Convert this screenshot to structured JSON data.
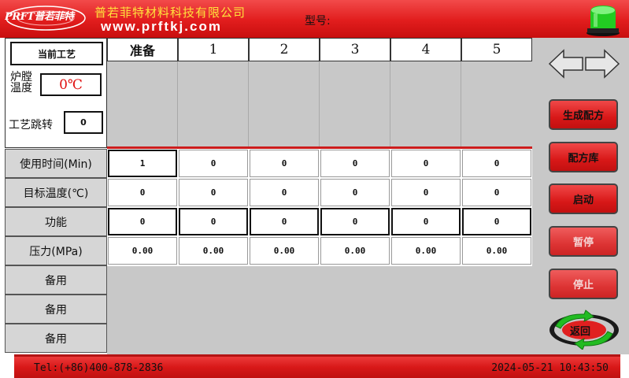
{
  "header": {
    "logo_text": "PRFT普若菲特",
    "company_name": "普若菲特材料科技有限公司",
    "website": "www.prftkj.com",
    "model_label": "型号:",
    "status_color": "#22cc22"
  },
  "info": {
    "current_process": "当前工艺",
    "furnace_label_1": "炉膛",
    "furnace_label_2": "温度",
    "furnace_temp": "0℃",
    "process_jump_label": "工艺跳转",
    "process_jump_value": "0"
  },
  "steps": [
    "准备",
    "1",
    "2",
    "3",
    "4",
    "5"
  ],
  "rows": [
    {
      "label": "使用时间(Min)",
      "values": [
        "1",
        "0",
        "0",
        "0",
        "0",
        "0"
      ]
    },
    {
      "label": "目标温度(℃)",
      "values": [
        "0",
        "0",
        "0",
        "0",
        "0",
        "0"
      ]
    },
    {
      "label": "功能",
      "values": [
        "0",
        "0",
        "0",
        "0",
        "0",
        "0"
      ]
    },
    {
      "label": "压力(MPa)",
      "values": [
        "0.00",
        "0.00",
        "0.00",
        "0.00",
        "0.00",
        "0.00"
      ]
    },
    {
      "label": "备用",
      "values": []
    },
    {
      "label": "备用",
      "values": []
    },
    {
      "label": "备用",
      "values": []
    }
  ],
  "buttons": {
    "generate_recipe": "生成配方",
    "recipe_library": "配方库",
    "start": "启动",
    "pause": "暂停",
    "stop": "停止",
    "back": "返回"
  },
  "footer": {
    "tel": "Tel:(+86)400-878-2836",
    "datetime": "2024-05-21 10:43:50"
  },
  "colors": {
    "accent_red": "#d81818",
    "panel_grey": "#c8c8c8",
    "warning_text": "#e01010"
  }
}
